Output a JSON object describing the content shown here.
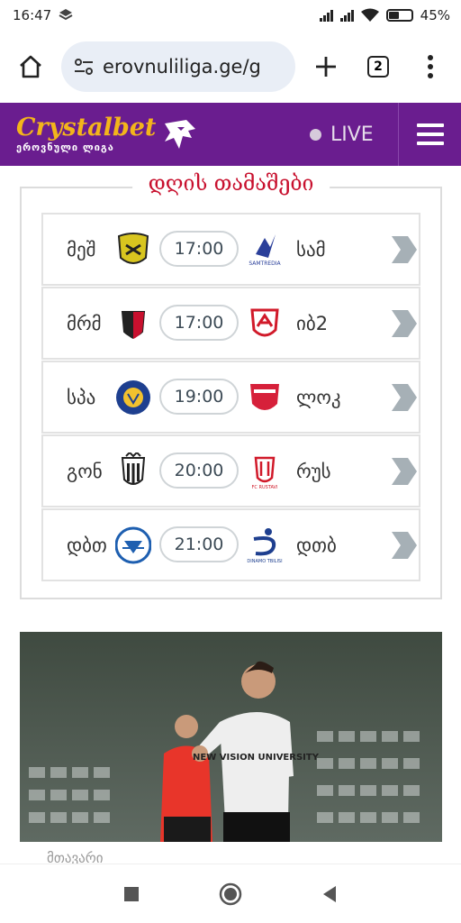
{
  "status_bar": {
    "time": "16:47",
    "battery_percent": "45%",
    "battery_level": 0.45
  },
  "browser": {
    "url": "erovnuliliga.ge/g",
    "tab_count": "2"
  },
  "header": {
    "brand": "Crystalbet",
    "brand_sub": "ეროვნული ლიგა",
    "live_label": "LIVE",
    "accent_color": "#6a1d8f",
    "brand_color": "#f3b51b"
  },
  "matches": {
    "title": "დღის თამაშები",
    "rows": [
      {
        "home": "მეშ",
        "time": "17:00",
        "away": "სამ",
        "home_crest": "meshakhte-crest",
        "away_crest": "samtredia-crest",
        "away_crest_text": "SAMTREDIA"
      },
      {
        "home": "მრმ",
        "time": "17:00",
        "away": "იბ2",
        "home_crest": "merani-crest",
        "away_crest": "iberia-crest",
        "away_crest_text": ""
      },
      {
        "home": "სპა",
        "time": "19:00",
        "away": "ლოკ",
        "home_crest": "spaeri-crest",
        "away_crest": "lokomotivi-crest",
        "away_crest_text": ""
      },
      {
        "home": "გონ",
        "time": "20:00",
        "away": "რუს",
        "home_crest": "gonio-crest",
        "away_crest": "rustavi-crest",
        "away_crest_text": "FC RUSTAVI"
      },
      {
        "home": "დბთ",
        "time": "21:00",
        "away": "დთბ",
        "home_crest": "dinamo-batumi-crest",
        "away_crest": "dinamo-tbilisi-crest",
        "away_crest_text": "DINAMO TBILISI"
      }
    ]
  },
  "news": {
    "caption": "მთავარი",
    "jersey_text": "NEW VISION UNIVERSITY"
  }
}
